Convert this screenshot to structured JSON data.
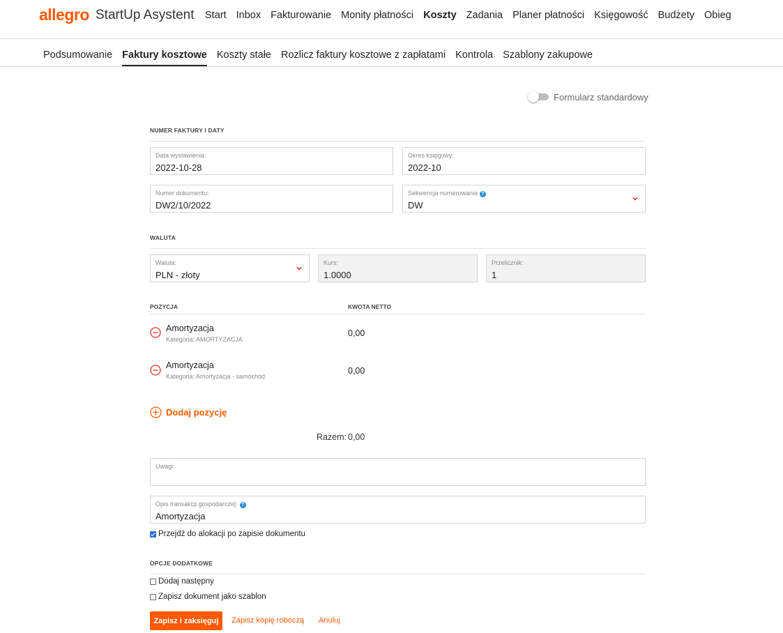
{
  "header": {
    "logo": "allegro",
    "app_name": "StartUp Asystent",
    "nav": [
      "Start",
      "Inbox",
      "Fakturowanie",
      "Monity płatności",
      "Koszty",
      "Zadania",
      "Planer płatności",
      "Księgowość",
      "Budżety",
      "Obieg"
    ],
    "active_nav": "Koszty"
  },
  "subnav": {
    "items": [
      "Podsumowanie",
      "Faktury kosztowe",
      "Koszty stałe",
      "Rozlicz faktury kosztowe z zapłatami",
      "Kontrola",
      "Szablony zakupowe"
    ],
    "active": "Faktury kosztowe"
  },
  "toggle": {
    "label": "Formularz standardowy",
    "on": false
  },
  "sections": {
    "invoice": "NUMER FAKTURY I DATY",
    "currency": "WALUTA",
    "extra": "OPCJE DODATKOWE"
  },
  "fields": {
    "issue_date": {
      "label": "Data wystawienia:",
      "value": "2022-10-28"
    },
    "period": {
      "label": "Okres księgowy:",
      "value": "2022-10"
    },
    "doc_number": {
      "label": "Numer dokumentu:",
      "value": "DW2/10/2022"
    },
    "sequence": {
      "label": "Sekwencja numerowania",
      "value": "DW"
    },
    "currency": {
      "label": "Waluta:",
      "value": "PLN - złoty"
    },
    "rate": {
      "label": "Kurs:",
      "value": "1.0000"
    },
    "converter": {
      "label": "Przelicznik:",
      "value": "1"
    },
    "notes": {
      "label": "Uwagi:",
      "value": ""
    },
    "description": {
      "label": "Opis transakcji gospodarczej:",
      "value": "Amortyzacja"
    }
  },
  "positions": {
    "col_position": "POZYCJA",
    "col_net": "KWOTA NETTO",
    "items": [
      {
        "name": "Amortyzacja",
        "category": "Kategoria: AMORTYZACJA",
        "amount": "0,00"
      },
      {
        "name": "Amortyzacja",
        "category": "Kategoria: Amortyzacja - samochód",
        "amount": "0,00"
      }
    ],
    "add_label": "Dodaj pozycję",
    "total_label": "Razem:",
    "total_value": "0,00"
  },
  "checkboxes": {
    "allocate": {
      "label": "Przejdź do alokacji po zapisie dokumentu",
      "checked": true
    },
    "add_next": {
      "label": "Dodaj następny",
      "checked": false
    },
    "save_template": {
      "label": "Zapisz dokument jako szablon",
      "checked": false
    }
  },
  "actions": {
    "save_post": "Zapisz i zaksięguj",
    "save_draft": "Zapisz kopię roboczą",
    "cancel": "Anuluj"
  },
  "colors": {
    "accent": "#ff5a00",
    "help": "#2a8dd4",
    "remove": "#e0302a"
  }
}
